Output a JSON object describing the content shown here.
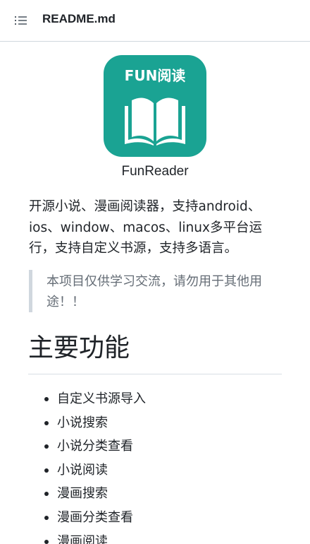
{
  "header": {
    "title": "README.md",
    "menu_icon": "list-icon"
  },
  "logo": {
    "text": "FUN阅读",
    "icon": "open-book-icon",
    "bg_color": "#1aa393"
  },
  "app_name": "FunReader",
  "description": "开源小说、漫画阅读器，支持android、ios、window、macos、linux多平台运行，支持自定义书源，支持多语言。",
  "notice": "本项目仅供学习交流，请勿用于其他用途！！",
  "features_heading": "主要功能",
  "features": [
    "自定义书源导入",
    "小说搜索",
    "小说分类查看",
    "小说阅读",
    "漫画搜索",
    "漫画分类查看",
    "漫画阅读"
  ]
}
